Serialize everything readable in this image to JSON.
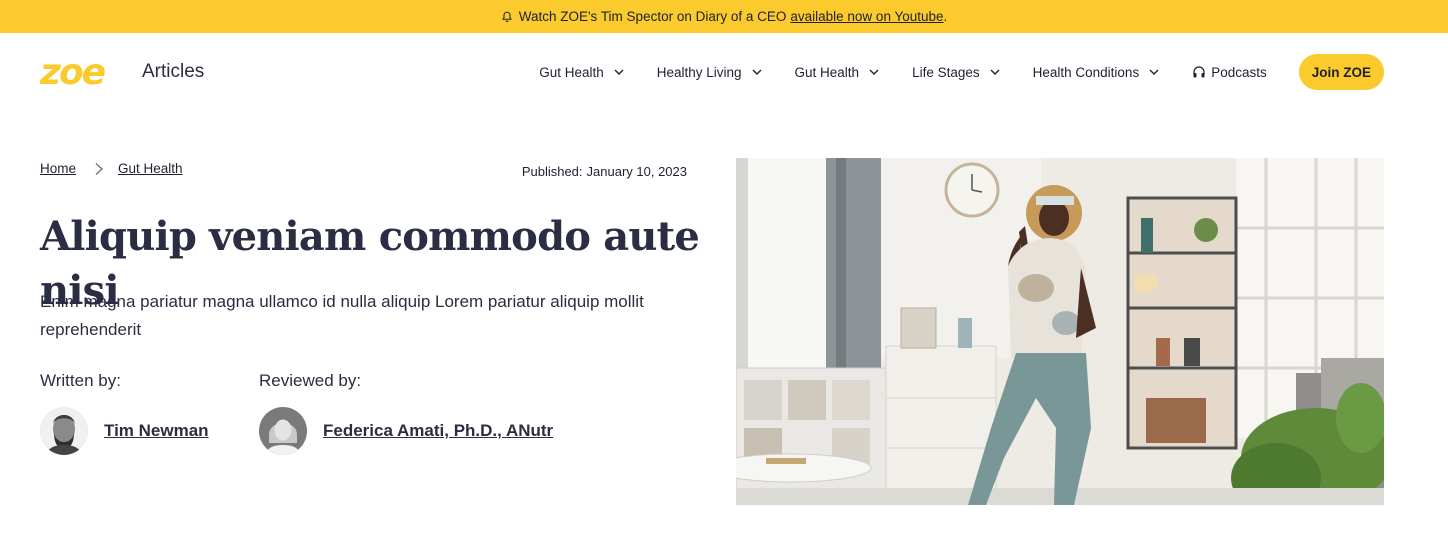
{
  "banner": {
    "text": "Watch ZOE's Tim Spector on Diary of a CEO",
    "link": "available now on Youtube",
    "suffix": ".",
    "icon": "bell-icon",
    "color": "#fbcb2d"
  },
  "header": {
    "logo_text": "zoe",
    "section": "Articles",
    "nav": [
      {
        "label": "Gut Health",
        "icon": "chevron-down-icon"
      },
      {
        "label": "Healthy Living",
        "icon": "chevron-down-icon"
      },
      {
        "label": "Gut Health",
        "icon": "chevron-down-icon"
      },
      {
        "label": "Life Stages",
        "icon": "chevron-down-icon"
      },
      {
        "label": "Health Conditions",
        "icon": "chevron-down-icon"
      }
    ],
    "podcasts": {
      "label": "Podcasts",
      "icon": "headphones-icon"
    },
    "join": "Join ZOE"
  },
  "article": {
    "breadcrumb": [
      {
        "label": "Home"
      },
      {
        "label": "Gut Health"
      }
    ],
    "published_label": "Published:",
    "published_date": "January 10, 2023",
    "title": "Aliquip veniam commodo aute nisi",
    "subtitle": "Enim magna pariatur magna ullamco id nulla aliquip Lorem pariatur aliquip mollit reprehenderit",
    "written_label": "Written by:",
    "author": "Tim Newman",
    "reviewed_label": "Reviewed by:",
    "reviewer": "Federica Amati, Ph.D., ANutr"
  },
  "colors": {
    "accent": "#fbcb2d",
    "text": "#2b2d42"
  }
}
